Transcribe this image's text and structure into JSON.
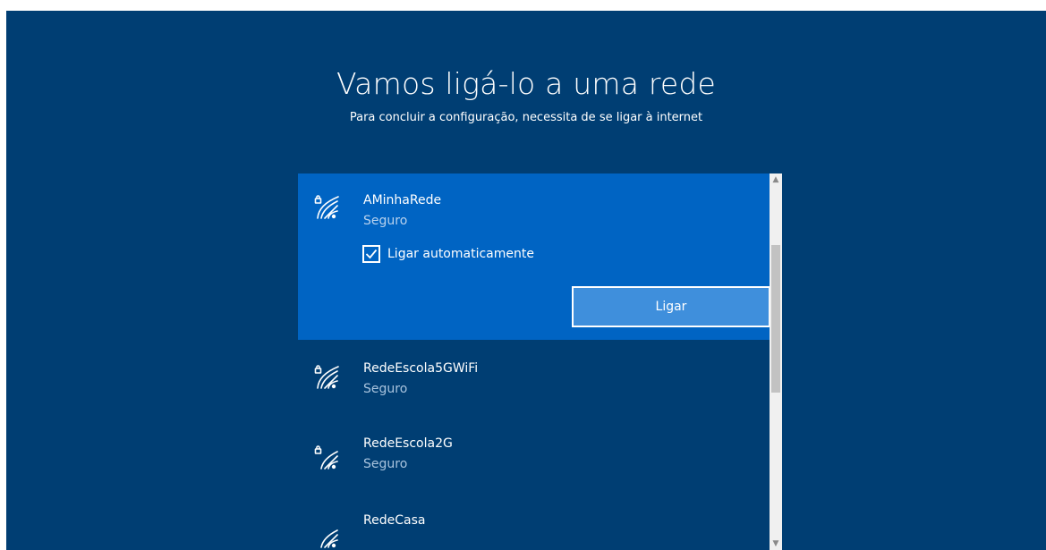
{
  "header": {
    "title": "Vamos ligá-lo a uma rede",
    "subtitle": "Para concluir a configuração, necessita de se ligar à internet"
  },
  "networks": [
    {
      "name": "AMinhaRede",
      "status": "Seguro",
      "secured": true,
      "selected": true,
      "auto_connect_label": "Ligar automaticamente",
      "auto_connect_checked": true,
      "connect_label": "Ligar"
    },
    {
      "name": "RedeEscola5GWiFi",
      "status": "Seguro",
      "secured": true
    },
    {
      "name": "RedeEscola2G",
      "status": "Seguro",
      "secured": true
    },
    {
      "name": "RedeCasa",
      "status": "",
      "secured": false
    }
  ],
  "icons": {
    "network": "wifi-secured-icon",
    "open_network": "wifi-icon",
    "scroll_up": "chevron-up-icon",
    "scroll_down": "chevron-down-icon",
    "checkbox": "checkmark-icon"
  },
  "colors": {
    "background": "#003e73",
    "selected_item": "#0064c3",
    "button": "#3f8fdc",
    "text": "#ffffff",
    "status_text": "#a9c4de"
  }
}
